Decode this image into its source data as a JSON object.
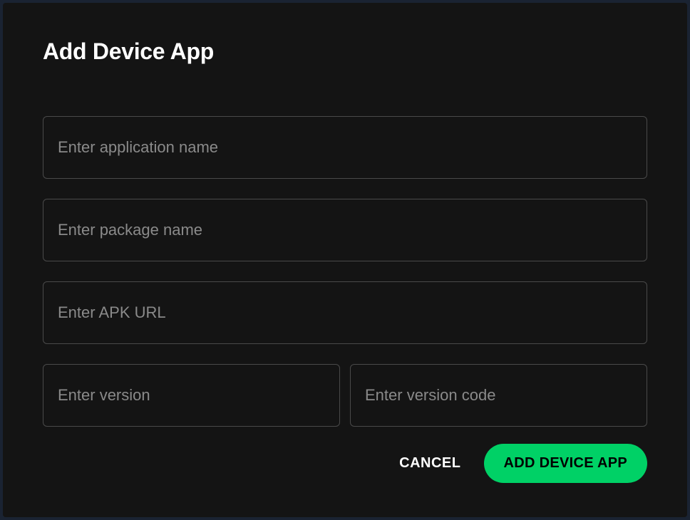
{
  "modal": {
    "title": "Add Device App",
    "fields": {
      "app_name": {
        "placeholder": "Enter application name",
        "value": ""
      },
      "package_name": {
        "placeholder": "Enter package name",
        "value": ""
      },
      "apk_url": {
        "placeholder": "Enter APK URL",
        "value": ""
      },
      "version": {
        "placeholder": "Enter version",
        "value": ""
      },
      "version_code": {
        "placeholder": "Enter version code",
        "value": ""
      }
    },
    "actions": {
      "cancel_label": "CANCEL",
      "submit_label": "ADD DEVICE APP"
    }
  }
}
